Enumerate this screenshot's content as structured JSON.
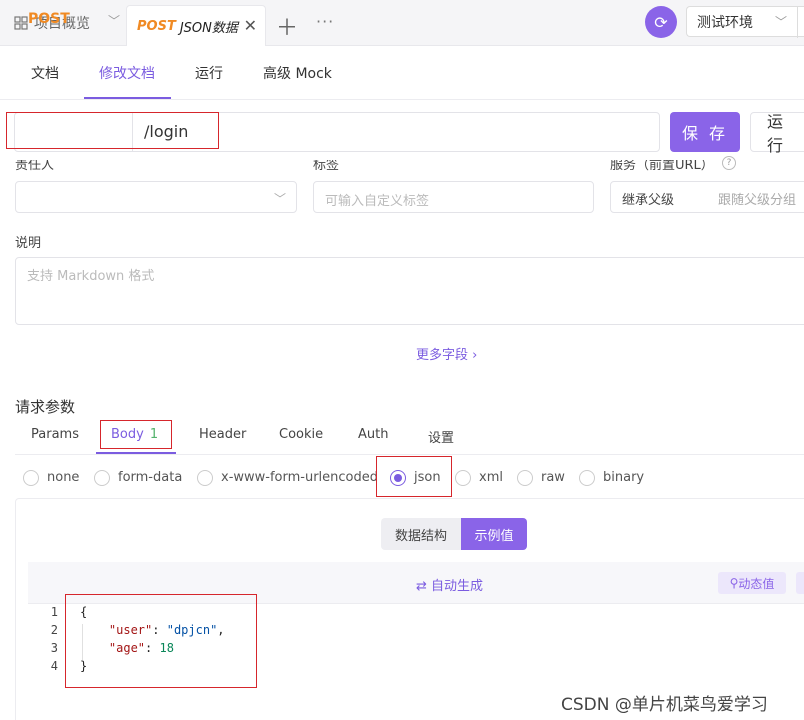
{
  "topbar": {
    "overview_label": "项目概览",
    "active_tab_method": "POST",
    "active_tab_title": "JSON数据",
    "env_label": "测试环境"
  },
  "subnav": {
    "items": [
      "文档",
      "修改文档",
      "运行",
      "高级 Mock"
    ],
    "active": "修改文档"
  },
  "request": {
    "method": "POST",
    "url": "/login",
    "save_label": "保 存",
    "run_label": "运 行"
  },
  "form": {
    "owner_label": "责任人",
    "tag_label": "标签",
    "tag_placeholder": "可输入自定义标签",
    "service_label": "服务（前置URL）",
    "service_value": "继承父级",
    "service_hint": "跟随父级分组",
    "desc_label": "说明",
    "desc_placeholder": "支持 Markdown 格式",
    "more_label": "更多字段"
  },
  "params": {
    "title": "请求参数",
    "tabs": [
      {
        "label": "Params"
      },
      {
        "label": "Body",
        "badge": "1"
      },
      {
        "label": "Header"
      },
      {
        "label": "Cookie"
      },
      {
        "label": "Auth"
      },
      {
        "label": "设置"
      }
    ],
    "active_tab": "Body",
    "body_types": [
      "none",
      "form-data",
      "x-www-form-urlencoded",
      "json",
      "xml",
      "raw",
      "binary"
    ],
    "selected_body_type": "json"
  },
  "editor": {
    "seg_structure": "数据结构",
    "seg_example": "示例值",
    "auto_generate": "自动生成",
    "dynamic_value": "动态值",
    "line_numbers": [
      "1",
      "2",
      "3",
      "4"
    ],
    "json": {
      "open": "{",
      "key1": "\"user\"",
      "val1": "\"dpjcn\"",
      "key2": "\"age\"",
      "val2": "18",
      "close": "}"
    }
  },
  "watermark": "CSDN @单片机菜鸟爱学习",
  "colors": {
    "accent": "#8a64e8",
    "method_post": "#f08a24",
    "annotation_red": "#d6262c"
  }
}
